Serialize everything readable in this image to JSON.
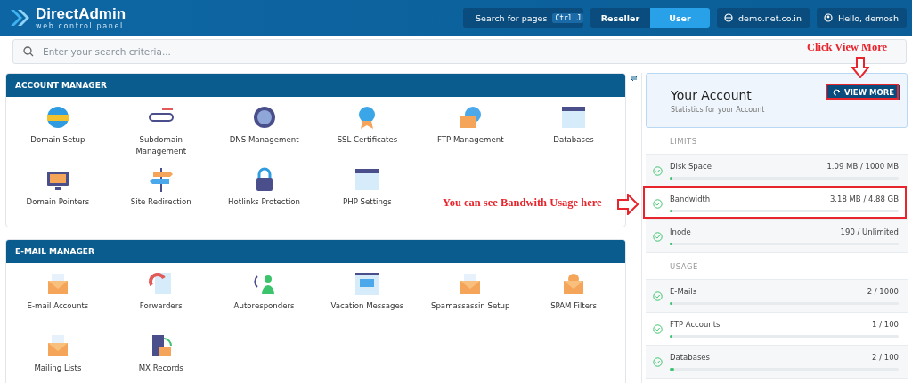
{
  "header": {
    "logo_title": "DirectAdmin",
    "logo_subtitle": "web control panel",
    "search_button": {
      "label": "Search for pages",
      "shortcut": "Ctrl J"
    },
    "modes": [
      {
        "label": "Reseller",
        "selected": false
      },
      {
        "label": "User",
        "selected": true
      }
    ],
    "domain": "demo.net.co.in",
    "user": "Hello, demosh"
  },
  "search": {
    "placeholder": "Enter your search criteria..."
  },
  "sections": [
    {
      "title": "ACCOUNT MANAGER",
      "items": [
        {
          "label": "Domain Setup"
        },
        {
          "label": "Subdomain Management"
        },
        {
          "label": "DNS Management"
        },
        {
          "label": "SSL Certificates"
        },
        {
          "label": "FTP Management"
        },
        {
          "label": "Databases"
        },
        {
          "label": "Domain Pointers"
        },
        {
          "label": "Site Redirection"
        },
        {
          "label": "Hotlinks Protection"
        },
        {
          "label": "PHP Settings"
        }
      ]
    },
    {
      "title": "E-MAIL MANAGER",
      "items": [
        {
          "label": "E-mail Accounts"
        },
        {
          "label": "Forwarders"
        },
        {
          "label": "Autoresponders"
        },
        {
          "label": "Vacation Messages"
        },
        {
          "label": "Spamassassin Setup"
        },
        {
          "label": "SPAM Filters"
        },
        {
          "label": "Mailing Lists"
        },
        {
          "label": "MX Records"
        }
      ]
    }
  ],
  "account": {
    "title": "Your Account",
    "subtitle": "Statistics for your Account",
    "button": "VIEW MORE",
    "rows": [
      {
        "kind": "heading",
        "label": "LIMITS"
      },
      {
        "kind": "stat",
        "label": "Disk Space",
        "reading": "1.09 MB / 1000 MB",
        "level": 0.001
      },
      {
        "kind": "stat",
        "label": "Bandwidth",
        "reading": "3.18 MB / 4.88 GB",
        "level": 0.001
      },
      {
        "kind": "stat",
        "label": "Inode",
        "reading": "190 / Unlimited",
        "level": 0
      },
      {
        "kind": "heading",
        "label": "USAGE"
      },
      {
        "kind": "stat",
        "label": "E-Mails",
        "reading": "2 / 1000",
        "level": 0.002
      },
      {
        "kind": "stat",
        "label": "FTP Accounts",
        "reading": "1 / 100",
        "level": 0.01
      },
      {
        "kind": "stat",
        "label": "Databases",
        "reading": "2 / 100",
        "level": 0.02
      }
    ]
  },
  "annotations": [
    {
      "text": "Click View More"
    },
    {
      "text": "You can see Bandwith Usage here"
    }
  ]
}
